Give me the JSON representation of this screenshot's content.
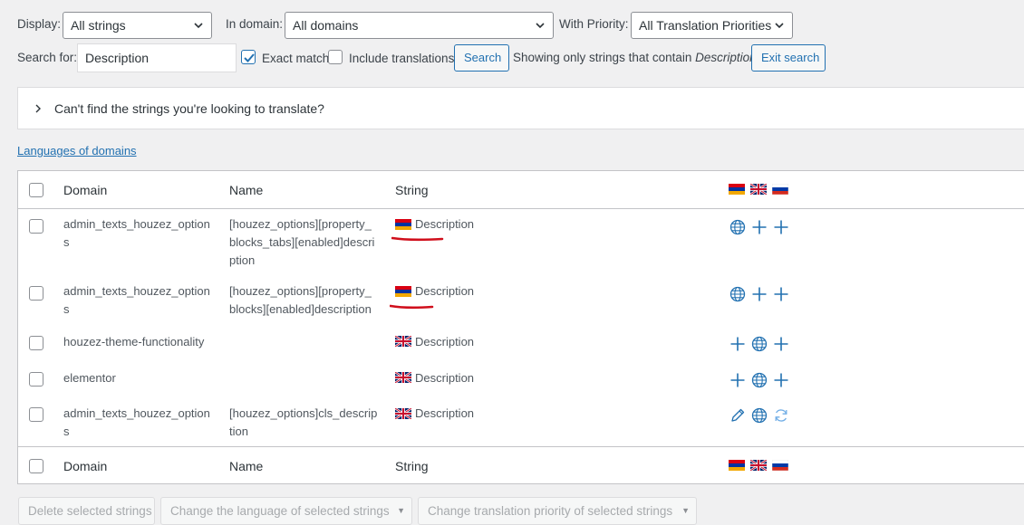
{
  "filters": {
    "display_label": "Display:",
    "display_value": "All strings",
    "domain_label": "In domain:",
    "domain_value": "All domains",
    "priority_label": "With Priority:",
    "priority_value": "All Translation Priorities"
  },
  "search": {
    "label": "Search for:",
    "value": "Description",
    "exact_match_label": "Exact match",
    "exact_match_checked": true,
    "include_translations_label": "Include translations",
    "include_translations_checked": false,
    "search_button": "Search",
    "showing_prefix": "Showing only strings that contain ",
    "showing_term": "Description",
    "exit_button": "Exit search"
  },
  "notice": {
    "text": "Can't find the strings you're looking to translate?"
  },
  "languages_link": "Languages of domains",
  "table": {
    "headers": {
      "domain": "Domain",
      "name": "Name",
      "string": "String"
    },
    "header_flags": [
      "flag-armenian",
      "flag-uk",
      "flag-russian"
    ],
    "rows": [
      {
        "domain_l1": "admin_texts_houzez_option",
        "domain_l2": "s",
        "name_l1": "[houzez_options][property_",
        "name_l2": "blocks_tabs][enabled]descri",
        "name_l3": "ption",
        "string": "Description",
        "flag": "flag-armenian",
        "actions": [
          "globe-icon",
          "plus-icon",
          "plus-icon"
        ]
      },
      {
        "domain_l1": "admin_texts_houzez_option",
        "domain_l2": "s",
        "name_l1": "[houzez_options][property_",
        "name_l2": "blocks][enabled]description",
        "name_l3": "",
        "string": "Description",
        "flag": "flag-armenian",
        "actions": [
          "globe-icon",
          "plus-icon",
          "plus-icon"
        ]
      },
      {
        "domain_l1": "houzez-theme-functionality",
        "domain_l2": "",
        "name_l1": "",
        "name_l2": "",
        "name_l3": "",
        "string": "Description",
        "flag": "flag-uk",
        "actions": [
          "plus-icon",
          "globe-icon",
          "plus-icon"
        ]
      },
      {
        "domain_l1": "elementor",
        "domain_l2": "",
        "name_l1": "",
        "name_l2": "",
        "name_l3": "",
        "string": "Description",
        "flag": "flag-uk",
        "actions": [
          "plus-icon",
          "globe-icon",
          "plus-icon"
        ]
      },
      {
        "domain_l1": "admin_texts_houzez_option",
        "domain_l2": "s",
        "name_l1": "[houzez_options]cls_descrip",
        "name_l2": "tion",
        "name_l3": "",
        "string": "Description",
        "flag": "flag-uk",
        "actions": [
          "pencil-icon",
          "globe-icon",
          "refresh-icon"
        ]
      }
    ]
  },
  "bulk": {
    "delete": "Delete selected strings",
    "change_language": "Change the language of selected strings",
    "change_priority": "Change translation priority of selected strings"
  },
  "colors": {
    "accent": "#2271b1",
    "annotation_red": "#d00f1c",
    "text": "#3c434a"
  }
}
